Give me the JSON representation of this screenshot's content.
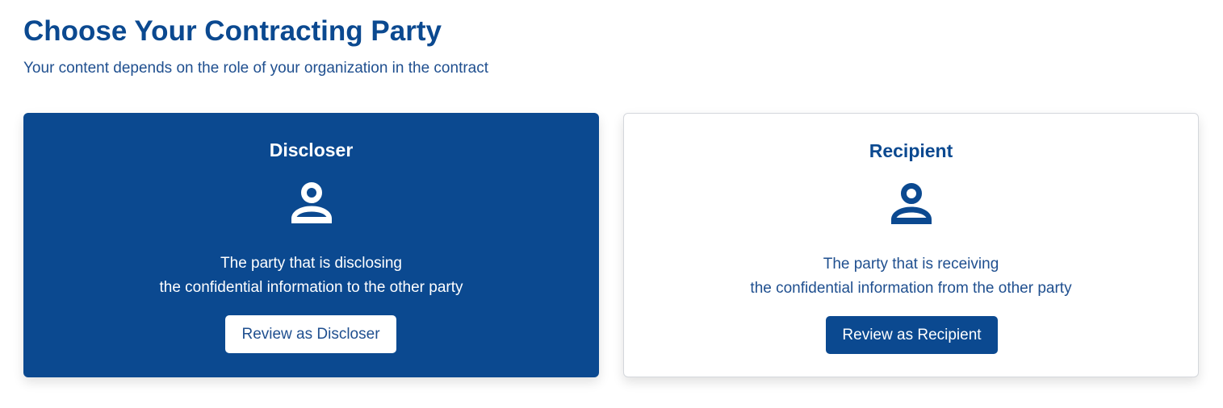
{
  "header": {
    "title": "Choose Your Contracting Party",
    "subtitle": "Your content depends on the role of your organization in the contract"
  },
  "colors": {
    "primary": "#0b4990",
    "text_secondary": "#1f4f8f",
    "card_border": "#d4d7dc",
    "background": "#ffffff"
  },
  "options": [
    {
      "title": "Discloser",
      "icon": "person-icon",
      "description_line1": "The party that is disclosing",
      "description_line2": "the confidential information to the other party",
      "button_label": "Review as Discloser",
      "selected": true
    },
    {
      "title": "Recipient",
      "icon": "person-icon",
      "description_line1": "The party that is receiving",
      "description_line2": "the confidential information from the other party",
      "button_label": "Review as Recipient",
      "selected": false
    }
  ]
}
